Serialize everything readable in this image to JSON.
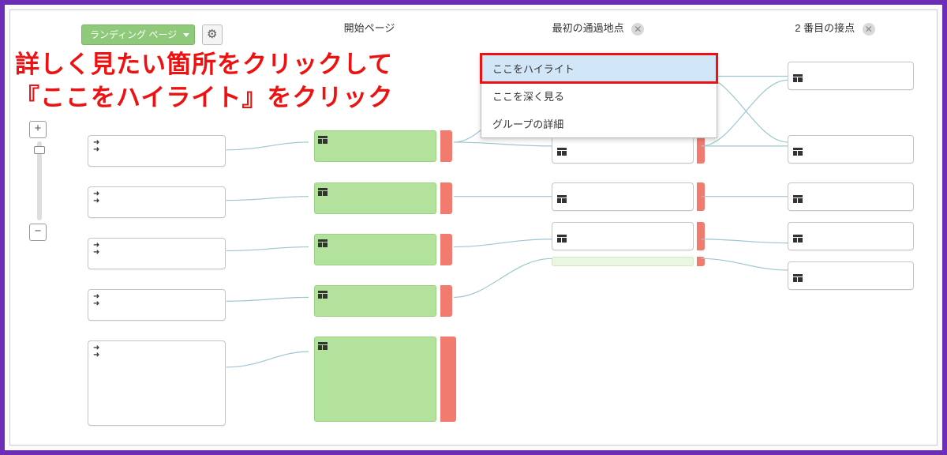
{
  "toolbar": {
    "landing_label": "ランディング ページ"
  },
  "columns": {
    "start": "開始ページ",
    "first": "最初の通過地点",
    "second": "2 番目の接点"
  },
  "context_menu": {
    "highlight": "ここをハイライト",
    "drilldown": "ここを深く見る",
    "group_detail": "グループの詳細"
  },
  "annotation": {
    "line1": "詳しく見たい箇所をクリックして",
    "line2": "『ここをハイライト』をクリック"
  },
  "zoom": {
    "plus": "+",
    "minus": "−"
  },
  "close_glyph": "✕"
}
